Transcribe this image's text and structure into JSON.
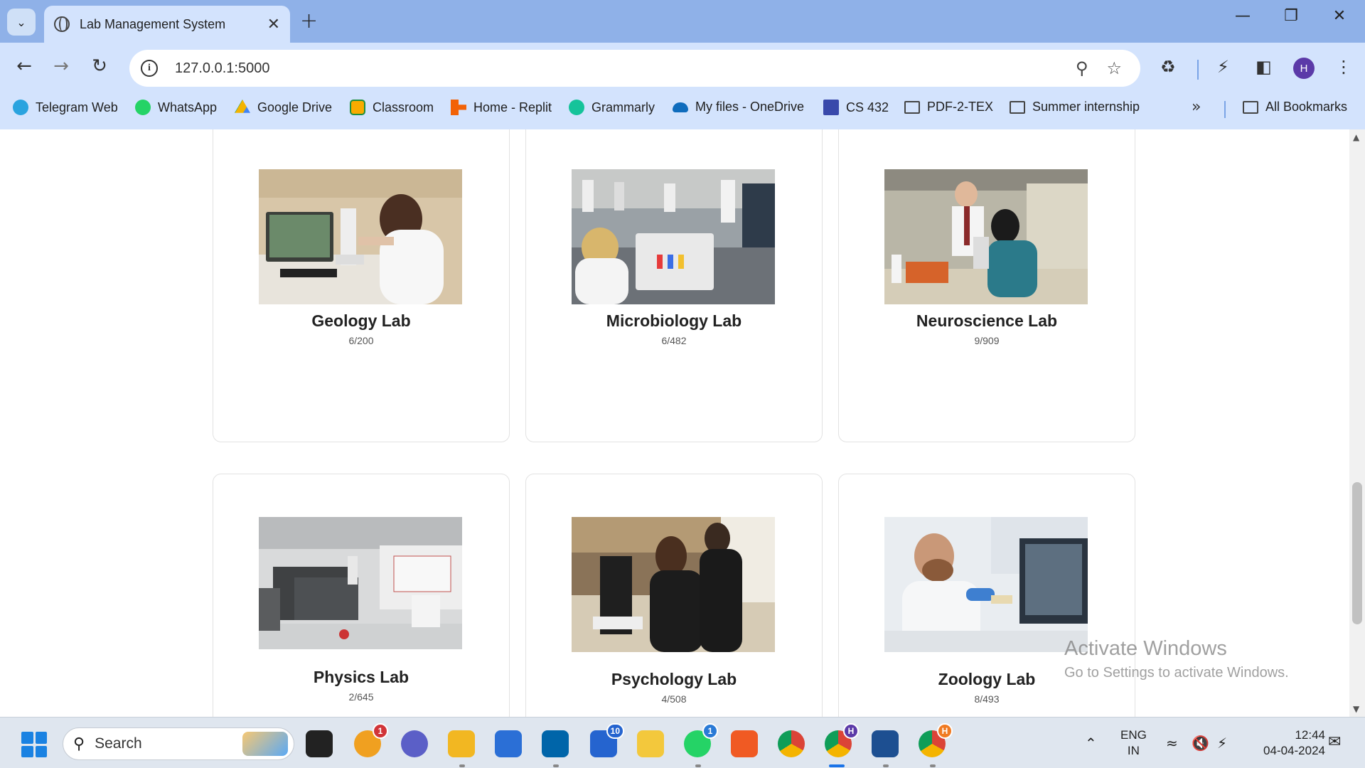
{
  "browser": {
    "tab_title": "Lab Management System",
    "url": "127.0.0.1:5000",
    "profile_initial": "H",
    "bookmarks": [
      {
        "label": "Telegram Web",
        "color": "#2aa3df"
      },
      {
        "label": "WhatsApp",
        "color": "#25d366"
      },
      {
        "label": "Google Drive",
        "color": "#f4b400"
      },
      {
        "label": "Classroom",
        "color": "#f9ab00"
      },
      {
        "label": "Home - Replit",
        "color": "#f26207"
      },
      {
        "label": "Grammarly",
        "color": "#15c39a"
      },
      {
        "label": "My files - OneDrive",
        "color": "#0f6cbd"
      },
      {
        "label": "CS 432",
        "color": "#3949ab"
      },
      {
        "label": "PDF-2-TEX",
        "color": "folder"
      },
      {
        "label": "Summer internship",
        "color": "folder"
      }
    ],
    "all_bookmarks_label": "All Bookmarks",
    "more_bookmarks_icon": "chevron-double-right-icon"
  },
  "labs": [
    {
      "name": "Geology Lab",
      "count": "6/200"
    },
    {
      "name": "Microbiology Lab",
      "count": "6/482"
    },
    {
      "name": "Neuroscience Lab",
      "count": "9/909"
    },
    {
      "name": "Physics Lab",
      "count": "2/645"
    },
    {
      "name": "Psychology Lab",
      "count": "4/508"
    },
    {
      "name": "Zoology Lab",
      "count": "8/493"
    }
  ],
  "watermark": {
    "title": "Activate Windows",
    "subtitle": "Go to Settings to activate Windows."
  },
  "taskbar": {
    "search_label": "Search",
    "language_line1": "ENG",
    "language_line2": "IN",
    "time": "12:44",
    "date": "04-04-2024",
    "badges": {
      "outlook": "1",
      "todo": "10",
      "whatsapp": "1",
      "chrome_profile": "H",
      "chrome_profile2": "H"
    }
  }
}
